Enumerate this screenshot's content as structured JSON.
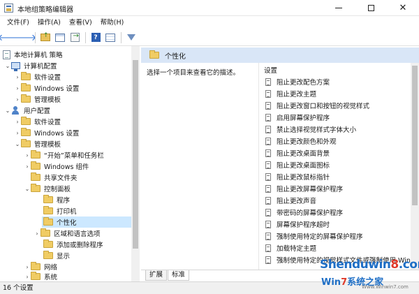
{
  "window": {
    "title": "本地组策略编辑器",
    "min_icon": "minimize-icon",
    "max_icon": "maximize-icon",
    "close_icon": "close-icon"
  },
  "menu": [
    "文件(F)",
    "操作(A)",
    "查看(V)",
    "帮助(H)"
  ],
  "toolbar": {
    "icons": [
      "back-arrow-icon",
      "forward-arrow-icon",
      "up-folder-icon",
      "show-hide-tree-icon",
      "export-list-icon",
      "help-icon",
      "properties-icon",
      "filter-icon"
    ]
  },
  "tree": {
    "root": "本地计算机 策略",
    "computer_config": "计算机配置",
    "software_settings": "软件设置",
    "windows_settings": "Windows 设置",
    "admin_templates": "管理模板",
    "user_config": "用户配置",
    "user_software_settings": "软件设置",
    "user_windows_settings": "Windows 设置",
    "user_admin_templates": "管理模板",
    "start_menu_taskbar": "“开始”菜单和任务栏",
    "windows_components": "Windows 组件",
    "shared_folders": "共享文件夹",
    "control_panel": "控制面板",
    "programs": "程序",
    "printers": "打印机",
    "personalization": "个性化",
    "region_language": "区域和语言选项",
    "add_remove_programs": "添加或删除程序",
    "display": "显示",
    "network": "网络",
    "system": "系统"
  },
  "right_pane": {
    "header": "个性化",
    "description": "选择一个项目来查看它的描述。",
    "column_header": "设置",
    "settings": [
      "阻止更改配色方案",
      "阻止更改主题",
      "阻止更改窗口和按钮的视觉样式",
      "启用屏幕保护程序",
      "禁止选择视觉样式字体大小",
      "阻止更改颜色和外观",
      "阻止更改桌面背景",
      "阻止更改桌面图标",
      "阻止更改鼠标指针",
      "阻止更改屏幕保护程序",
      "阻止更改声音",
      "带密码的屏幕保护程序",
      "屏幕保护程序超时",
      "强制使用特定的屏幕保护程序",
      "加载特定主题",
      "强制使用特定的视觉样式文件或强制使用 Win"
    ],
    "tabs": [
      "扩展",
      "标准"
    ]
  },
  "status": "16 个设置",
  "watermark": {
    "part1": "Shenduwin",
    "part2": "8",
    "part3": ".com",
    "sub_a": "Win",
    "sub_b": "7",
    "sub_c": "系统之家",
    "url": "Www.Winwin7.com"
  }
}
